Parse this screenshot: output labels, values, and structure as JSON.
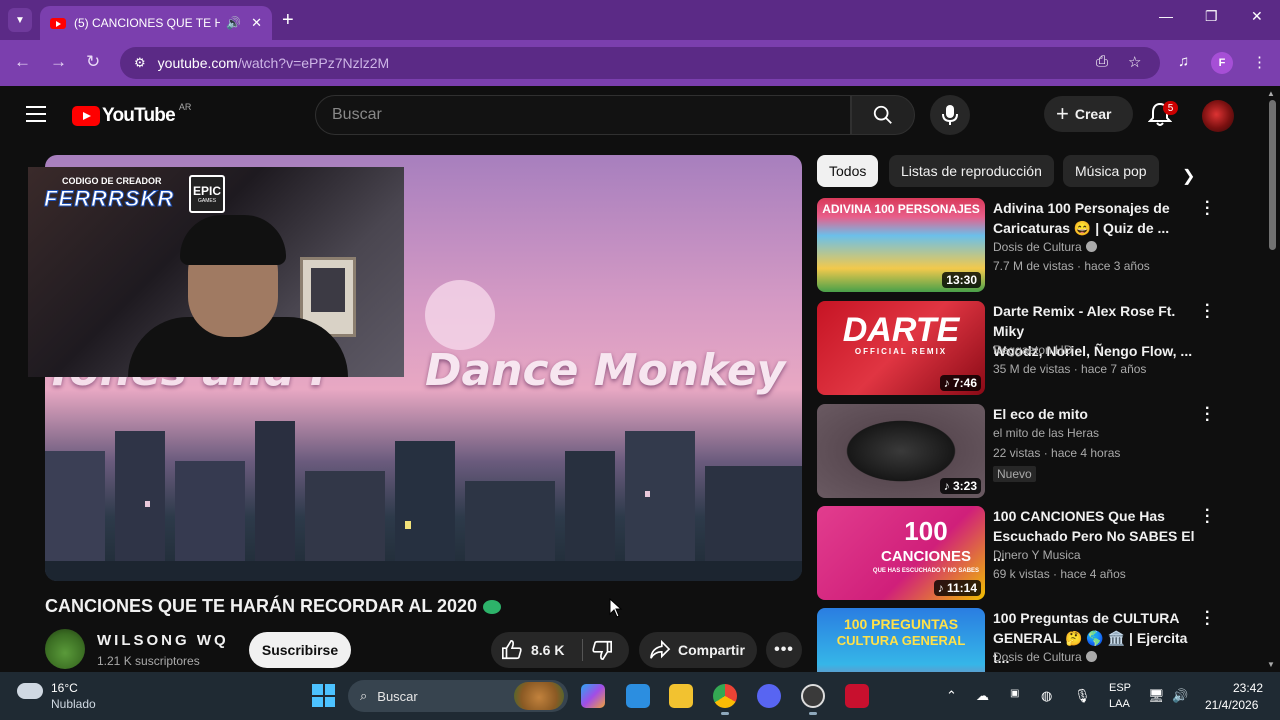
{
  "browser": {
    "tab_title": "(5) CANCIONES QUE TE HA",
    "url_host": "youtube.com",
    "url_path": "/watch?v=ePPz7Nzlz2M",
    "profile_initial": "F"
  },
  "header": {
    "logo_text": "YouTube",
    "country_code": "AR",
    "search_placeholder": "Buscar",
    "create_label": "Crear",
    "notifications_count": "5"
  },
  "player": {
    "overlay_text_left": "Tones and I",
    "overlay_text_right": "Dance Monkey",
    "creator_code_label": "CODIGO DE CREADOR",
    "creator_code": "FERRRSKR",
    "epic_label": "EPIC",
    "epic_sub": "GAMES"
  },
  "video": {
    "title": "CANCIONES QUE TE HARÁN RECORDAR AL 2020",
    "channel_name": "WILSONG WQ",
    "subscribers": "1.21 K suscriptores",
    "subscribe_label": "Suscribirse",
    "likes": "8.6 K",
    "share_label": "Compartir"
  },
  "chips": [
    "Todos",
    "Listas de reproducción",
    "Música pop"
  ],
  "recommendations": [
    {
      "thumb_text": "ADIVINA 100 PERSONAJES",
      "title_line1": "Adivina 100 Personajes de",
      "title_line2": "Caricaturas 😄 | Quiz de ...",
      "channel": "Dosis de Cultura",
      "meta": "7.7 M de vistas · hace 3 años",
      "duration": "13:30"
    },
    {
      "thumb_text": "DARTE",
      "thumb_sub": "OFFICIAL REMIX",
      "title_line1": "Darte Remix - Alex Rose Ft. Miky",
      "title_line2": "Woodz, Noriel, Ñengo Flow, ...",
      "channel": "Reggaeton HD",
      "meta": "35 M de vistas · hace 7 años",
      "duration": "♪ 7:46"
    },
    {
      "title_line1": "El eco de mito",
      "channel": "el mito de las Heras",
      "meta": "22 vistas · hace 4 horas",
      "badge": "Nuevo",
      "duration": "♪ 3:23"
    },
    {
      "thumb_text": "100",
      "thumb_sub": "CANCIONES",
      "thumb_sub2": "QUE HAS ESCUCHADO Y NO SABES",
      "title_line1": "100 CANCIONES Que Has",
      "title_line2": "Escuchado Pero No SABES El ...",
      "channel": "Dinero Y Musica",
      "meta": "69 k vistas · hace 4 años",
      "duration": "♪ 11:14"
    },
    {
      "thumb_text": "100 PREGUNTAS",
      "thumb_sub": "CULTURA GENERAL",
      "title_line1": "100 Preguntas de CULTURA",
      "title_line2": "GENERAL 🤔 🌎 🏛️ | Ejercita t...",
      "channel": "Dosis de Cultura"
    }
  ],
  "taskbar": {
    "temperature": "16°C",
    "condition": "Nublado",
    "search_label": "Buscar",
    "lang_line1": "ESP",
    "lang_line2": "LAA",
    "time": "23:42",
    "date": "21/4/2026"
  },
  "colors": {
    "tab_strip": "#5b2a86",
    "toolbar": "#7b3fae",
    "yt_red": "#ff0000",
    "page_bg": "#0f0f0f"
  }
}
